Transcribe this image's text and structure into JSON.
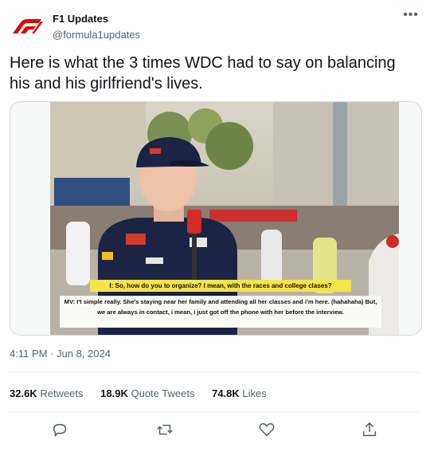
{
  "account": {
    "name": "F1 Updates",
    "handle": "@formula1updates",
    "logo_color": "#e10600",
    "more_icon": "ellipsis-icon"
  },
  "tweet": {
    "text": "Here is what the 3 times WDC had to say on balancing his and his girlfriend's lives.",
    "timestamp": "4:11 PM · Jun 8, 2024"
  },
  "media": {
    "question": "I: So, how do you to organize? I mean, with the races and college clases?",
    "answer": "MV: I't simple really. She's staying near her family and attending all her classes and i'm here. (hahahaha) But, we are always in contact, i mean, i just got off the phone with her before the interview.",
    "caption_color": "#f7e34a"
  },
  "stats": {
    "retweets_count": "32.6K",
    "retweets_label": "Retweets",
    "quotes_count": "18.9K",
    "quotes_label": "Quote Tweets",
    "likes_count": "74.8K",
    "likes_label": "Likes"
  },
  "actions": [
    "reply-icon",
    "retweet-icon",
    "like-icon",
    "share-icon"
  ]
}
